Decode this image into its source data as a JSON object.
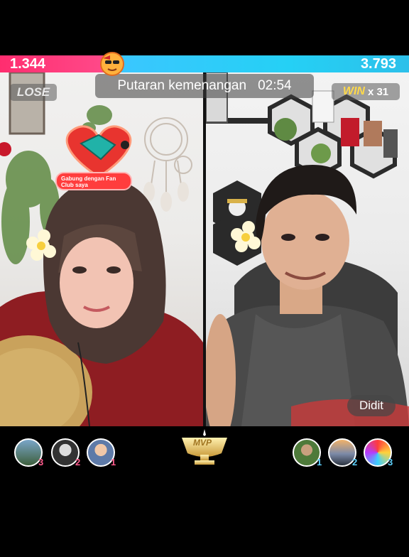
{
  "battle": {
    "left_score": "1.344",
    "right_score": "3.793",
    "left_share": 0.262,
    "round_title": "Putaran kemenangan",
    "timer": "02:54",
    "left_result": "LOSE",
    "right_result_word": "WIN",
    "right_result_count": "x 31"
  },
  "left_host": {
    "fan_club_prompt": "Gabung dengan Fan Club saya"
  },
  "right_host": {
    "name": "Didit"
  },
  "top_gifters": {
    "left": [
      {
        "rank": "3",
        "avatar": "avatar-landscape-icon"
      },
      {
        "rank": "2",
        "avatar": "avatar-person-icon"
      },
      {
        "rank": "1",
        "avatar": "avatar-person-icon"
      }
    ],
    "right": [
      {
        "rank": "1",
        "avatar": "avatar-person-icon"
      },
      {
        "rank": "2",
        "avatar": "avatar-sunset-icon"
      },
      {
        "rank": "3",
        "avatar": "avatar-colorful-icon"
      }
    ]
  },
  "mvp_label": "MVP",
  "colors": {
    "left_team": "#ff2d6f",
    "right_team": "#2cc6f2",
    "win_gold": "#ffd94a"
  }
}
